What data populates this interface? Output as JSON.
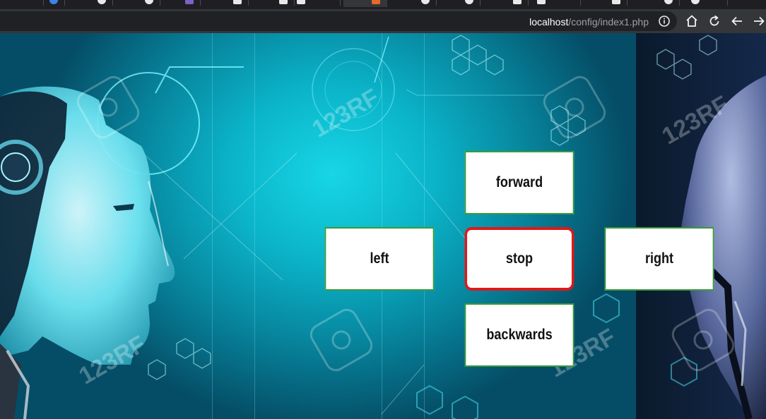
{
  "browser": {
    "url_host": "localhost",
    "url_path": "/config/index1.php",
    "tabs": [
      {
        "favicon": "tab-favicon-icon"
      },
      {
        "favicon": "tab-favicon-icon"
      },
      {
        "favicon": "tab-favicon-icon"
      },
      {
        "favicon": "tab-favicon-icon"
      },
      {
        "favicon": "tab-favicon-icon"
      },
      {
        "favicon": "tab-favicon-icon"
      },
      {
        "favicon": "tab-favicon-icon"
      },
      {
        "favicon": "tab-favicon-icon"
      },
      {
        "favicon": "tab-favicon-icon"
      },
      {
        "favicon": "tab-favicon-icon"
      },
      {
        "favicon": "tab-favicon-icon"
      },
      {
        "favicon": "tab-favicon-icon"
      },
      {
        "favicon": "tab-favicon-icon"
      },
      {
        "favicon": "tab-favicon-icon"
      },
      {
        "favicon": "tab-favicon-icon"
      },
      {
        "favicon": "tab-favicon-icon"
      }
    ],
    "icons": {
      "info": "info-icon",
      "home": "home-icon",
      "reload": "reload-icon",
      "back": "back-arrow-icon",
      "forward": "forward-arrow-icon"
    }
  },
  "controls": {
    "forward": "forward",
    "left": "left",
    "stop": "stop",
    "right": "right",
    "backwards": "backwards"
  },
  "background": {
    "watermark_text": "123RF",
    "colors": {
      "cyan_glow": "#17d6e6",
      "deep_teal": "#054d66",
      "button_border": "#3a9a3a",
      "stop_border": "#e01818"
    }
  }
}
